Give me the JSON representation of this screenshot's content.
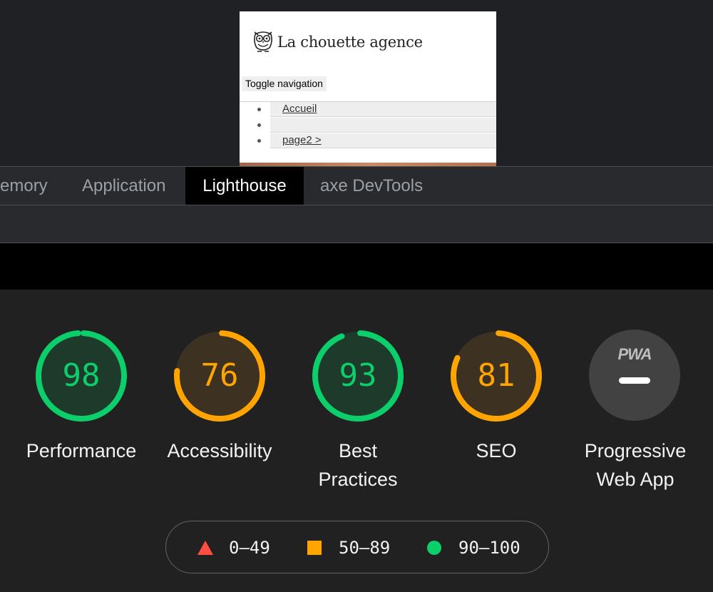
{
  "preview": {
    "brand_name": "La chouette agence",
    "toggle_label": "Toggle navigation",
    "nav_items": [
      "Accueil",
      "",
      "page2 >"
    ]
  },
  "devtools": {
    "tabs": [
      "emory",
      "Application",
      "Lighthouse",
      "axe DevTools"
    ],
    "active_tab": "Lighthouse"
  },
  "lighthouse": {
    "categories": [
      {
        "label": "Performance",
        "score": 98,
        "status": "pass"
      },
      {
        "label": "Accessibility",
        "score": 76,
        "status": "average"
      },
      {
        "label": "Best Practices",
        "score": 93,
        "status": "pass"
      },
      {
        "label": "SEO",
        "score": 81,
        "status": "average"
      }
    ],
    "pwa": {
      "badge": "PWA",
      "label": "Progressive Web App"
    },
    "legend": [
      {
        "range": "0–49",
        "shape": "triangle"
      },
      {
        "range": "50–89",
        "shape": "square"
      },
      {
        "range": "90–100",
        "shape": "circle"
      }
    ],
    "colors": {
      "pass": "#0cce6b",
      "pass_bg": "#1e3a2b",
      "average": "#ffa400",
      "average_bg": "#3d3221",
      "fail": "#ff4e42"
    }
  }
}
